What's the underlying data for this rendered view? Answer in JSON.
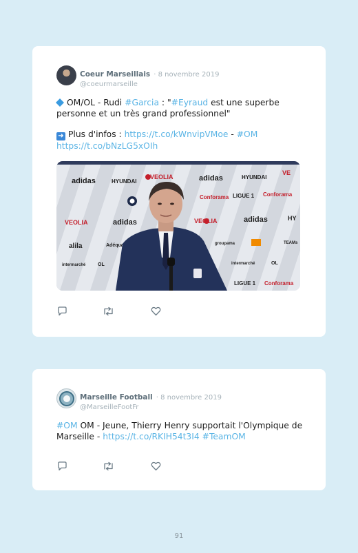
{
  "tweets": [
    {
      "author": "Coeur Marseillais",
      "date": "· 8 novembre 2019",
      "handle": "@coeurmarseille",
      "line1": {
        "prefix": "OM/OL - Rudi ",
        "hashtag1": "#Garcia",
        "mid": " : \"",
        "hashtag2": "#Eyraud",
        "suffix": " est une superbe"
      },
      "line2": "personne et un très grand professionnel\"",
      "line3": {
        "prefix": "Plus d'infos : ",
        "link1": "https://t.co/kWnvipVMoe",
        "sep": " - ",
        "hashtag": "#OM"
      },
      "line4": "https://t.co/bNzLG5xOIh",
      "photo": {
        "sponsors_row1": [
          "adidas",
          "HYUNDAI",
          "VEOLIA",
          "adidas",
          "HYUNDAI",
          "VE"
        ],
        "sponsors_row2": [
          "Conforama",
          "LIGUE 1",
          "Conforama"
        ],
        "sponsors_row3": [
          "VEOLIA",
          "adidas",
          "VEOLIA",
          "adidas",
          "HY"
        ],
        "sponsors_row4": [
          "alila",
          "Adéquat",
          "groupama",
          "TEAMs"
        ],
        "sponsors_row5": [
          "intermarché",
          "OL",
          "intermarché",
          "OL"
        ],
        "sponsors_row6": [
          "LIGUE 1",
          "Conforama"
        ]
      }
    },
    {
      "author": "Marseille Football",
      "date": "· 8 novembre 2019",
      "handle": "@MarseilleFootFr",
      "line1": {
        "hashtag": "#OM",
        "text": " OM - Jeune, Thierry Henry supportait l'Olympique de"
      },
      "line2": {
        "prefix": "Marseille - ",
        "link": "https://t.co/RKIH54t3I4",
        "sep": " ",
        "hashtag": "#TeamOM"
      }
    }
  ],
  "icons": {
    "reply": "reply-icon",
    "retweet": "retweet-icon",
    "like": "heart-icon",
    "bullet1": "blue-diamond-icon",
    "bullet2": "right-arrow-icon"
  },
  "colors": {
    "page_bg": "#d9edf6",
    "card_bg": "#ffffff",
    "link": "#5ab4e5",
    "name": "#5d6e79",
    "muted": "#a6b2b9"
  },
  "page_number": "91"
}
